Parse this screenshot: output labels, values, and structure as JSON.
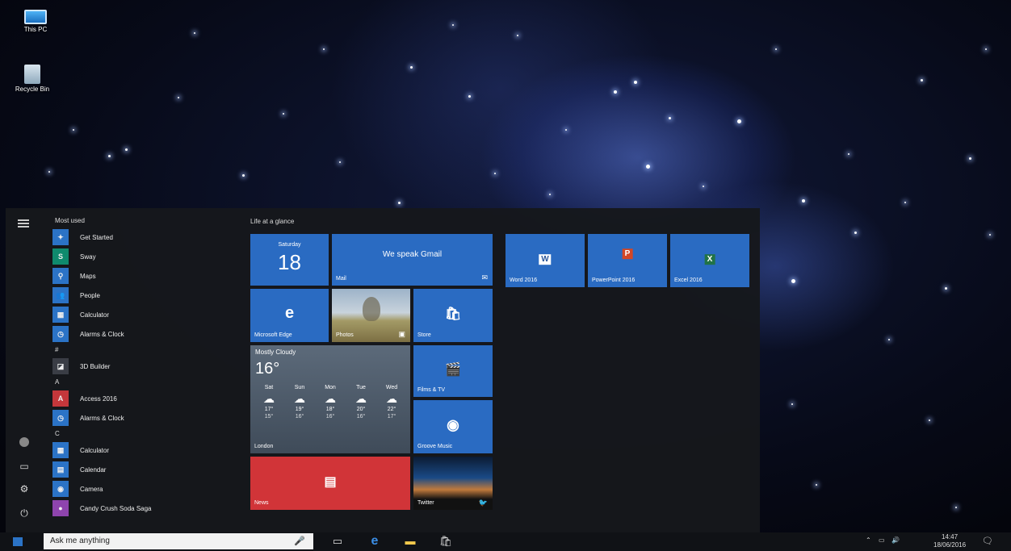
{
  "desktop": {
    "icons": [
      {
        "label": "This PC",
        "icon": "this-pc-icon"
      },
      {
        "label": "Recycle Bin",
        "icon": "recycle-bin-icon"
      }
    ]
  },
  "start": {
    "most_used_title": "Most used",
    "most_used": [
      {
        "label": "Get Started",
        "icon": "lightbulb-icon",
        "glyph": "✦",
        "color": "#2b73c6"
      },
      {
        "label": "Sway",
        "icon": "sway-icon",
        "glyph": "S",
        "color": "#0f8a6d"
      },
      {
        "label": "Maps",
        "icon": "maps-icon",
        "glyph": "⚲",
        "color": "#2b73c6"
      },
      {
        "label": "People",
        "icon": "people-icon",
        "glyph": "👥",
        "color": "#2b73c6"
      },
      {
        "label": "Calculator",
        "icon": "calculator-icon",
        "glyph": "▦",
        "color": "#2b73c6"
      },
      {
        "label": "Alarms & Clock",
        "icon": "clock-icon",
        "glyph": "◷",
        "color": "#2b73c6"
      }
    ],
    "sections": [
      {
        "letter": "#",
        "apps": [
          {
            "label": "3D Builder",
            "icon": "3d-builder-icon",
            "glyph": "◪",
            "color": "#3a3d45"
          }
        ]
      },
      {
        "letter": "A",
        "apps": [
          {
            "label": "Access 2016",
            "icon": "access-icon",
            "glyph": "A",
            "color": "#c4373b"
          },
          {
            "label": "Alarms & Clock",
            "icon": "clock-icon",
            "glyph": "◷",
            "color": "#2b73c6"
          }
        ]
      },
      {
        "letter": "C",
        "apps": [
          {
            "label": "Calculator",
            "icon": "calculator-icon",
            "glyph": "▦",
            "color": "#2b73c6"
          },
          {
            "label": "Calendar",
            "icon": "calendar-icon",
            "glyph": "▤",
            "color": "#2b73c6"
          },
          {
            "label": "Camera",
            "icon": "camera-icon",
            "glyph": "◉",
            "color": "#2b73c6"
          },
          {
            "label": "Candy Crush Soda Saga",
            "icon": "candy-crush-icon",
            "glyph": "●",
            "color": "#8e44ad"
          }
        ]
      }
    ],
    "group_title": "Life at a glance",
    "tiles": {
      "calendar": {
        "day": "Saturday",
        "date": "18"
      },
      "mail": {
        "text": "We speak Gmail",
        "label": "Mail"
      },
      "edge": {
        "label": "Microsoft Edge"
      },
      "photos": {
        "label": "Photos"
      },
      "store": {
        "label": "Store"
      },
      "weather": {
        "condition": "Mostly Cloudy",
        "temp": "16°",
        "location": "London",
        "days": [
          {
            "day": "Sat",
            "hi": "17°",
            "lo": "15°"
          },
          {
            "day": "Sun",
            "hi": "19°",
            "lo": "16°"
          },
          {
            "day": "Mon",
            "hi": "18°",
            "lo": "16°"
          },
          {
            "day": "Tue",
            "hi": "20°",
            "lo": "16°"
          },
          {
            "day": "Wed",
            "hi": "22°",
            "lo": "17°"
          }
        ]
      },
      "films": {
        "label": "Films & TV"
      },
      "groove": {
        "label": "Groove Music"
      },
      "news": {
        "label": "News"
      },
      "twitter": {
        "label": "Twitter"
      },
      "word": {
        "label": "Word 2016"
      },
      "powerpoint": {
        "label": "PowerPoint 2016"
      },
      "excel": {
        "label": "Excel 2016"
      }
    }
  },
  "taskbar": {
    "search_placeholder": "Ask me anything",
    "time": "14:47",
    "date": "18/06/2016"
  },
  "colors": {
    "accent": "#2a6bc2",
    "news": "#d13438",
    "word": "#2b579a",
    "powerpoint": "#d24726",
    "excel": "#217346"
  }
}
